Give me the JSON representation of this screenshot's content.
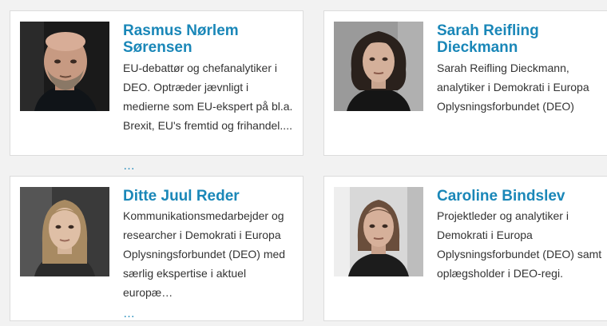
{
  "colors": {
    "accent": "#1a87b8",
    "text": "#333333",
    "card_bg": "#ffffff",
    "page_bg": "#f2f2f2"
  },
  "people": [
    {
      "name": "Rasmus Nørlem Sørensen",
      "bio": "EU-debattør og chefanalytiker i DEO. Optræder jævnligt i medierne som EU-ekspert på bl.a. Brexit, EU's fremtid og frihandel....",
      "more": "…",
      "photo": "portrait-rasmus"
    },
    {
      "name": "Sarah Reifling Dieckmann",
      "bio": "Sarah Reifling Dieckmann, analytiker i Demokrati i Europa Oplysningsforbundet (DEO)",
      "photo": "portrait-sarah"
    },
    {
      "name": "Ditte Juul Reder",
      "bio": "Kommunikationsmedarbejder og researcher i Demokrati i Europa Oplysningsforbundet (DEO) med særlig ekspertise i aktuel europæ…",
      "more": "…",
      "photo": "portrait-ditte"
    },
    {
      "name": "Caroline Bindslev",
      "bio": "Projektleder og analytiker i Demokrati i Europa Oplysningsforbundet (DEO) samt oplægsholder i DEO-regi.",
      "photo": "portrait-caroline"
    }
  ]
}
